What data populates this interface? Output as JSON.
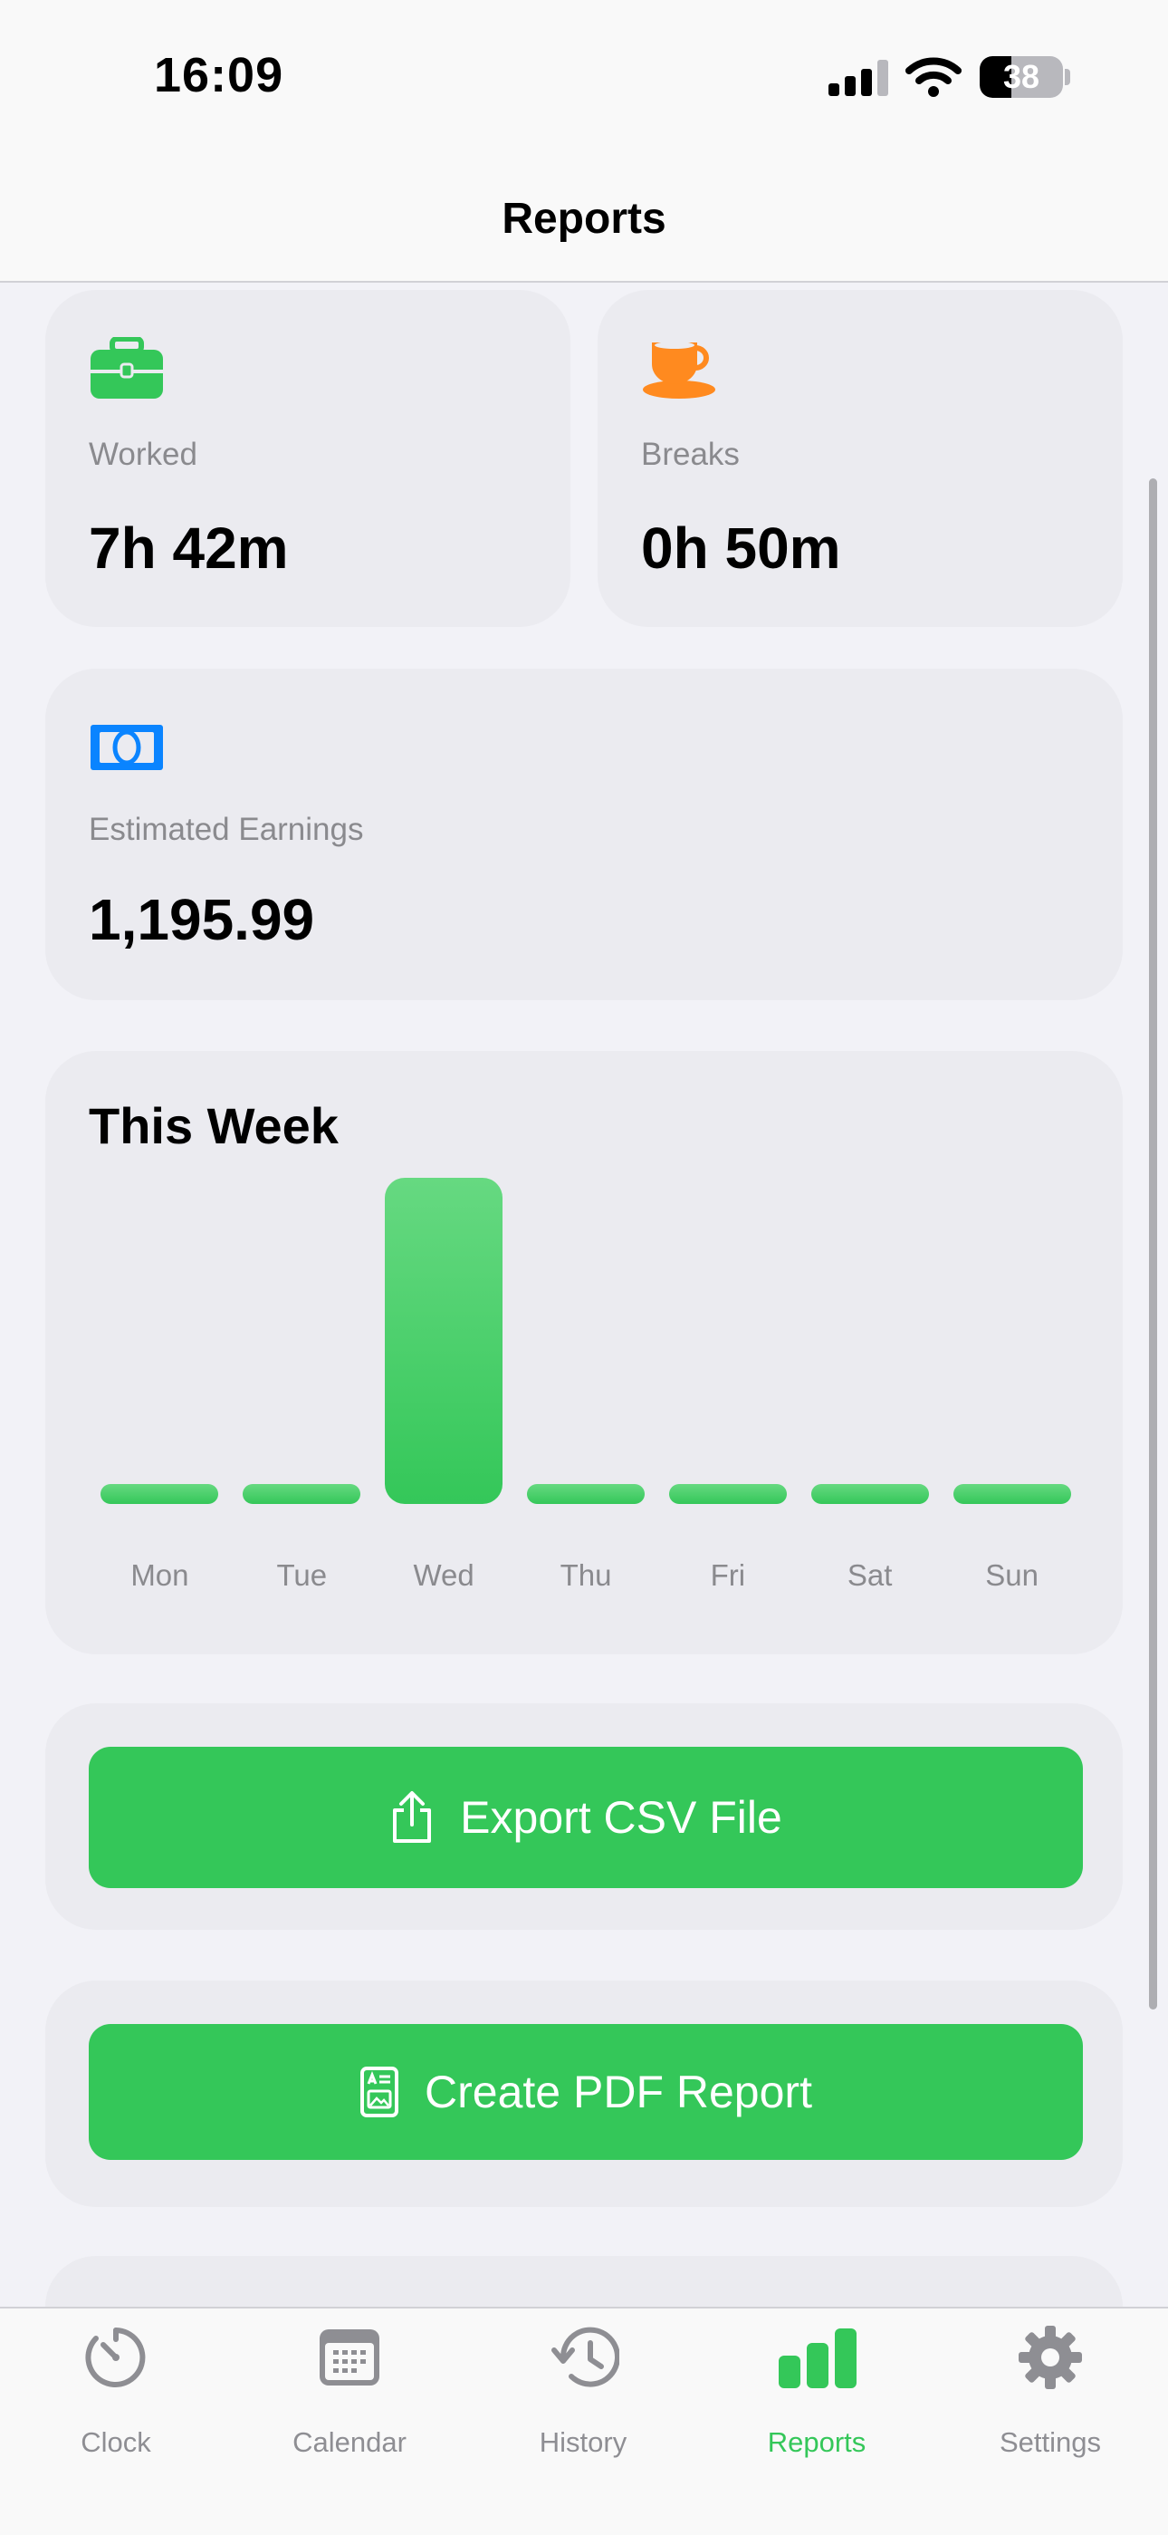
{
  "status_bar": {
    "time": "16:09",
    "battery_level": "38",
    "battery_fraction": 0.38
  },
  "nav": {
    "title": "Reports"
  },
  "stats": {
    "worked": {
      "label": "Worked",
      "value": "7h 42m",
      "icon": "briefcase-icon",
      "color": "#34C759"
    },
    "breaks": {
      "label": "Breaks",
      "value": "0h 50m",
      "icon": "coffee-cup-icon",
      "color": "#FF8A1F"
    },
    "earnings": {
      "label": "Estimated Earnings",
      "value": "1,195.99",
      "icon": "banknote-icon",
      "color": "#0A84FF"
    }
  },
  "chart_data": {
    "type": "bar",
    "title": "This Week",
    "categories": [
      "Mon",
      "Tue",
      "Wed",
      "Thu",
      "Fri",
      "Sat",
      "Sun"
    ],
    "values": [
      0,
      0,
      7.7,
      0,
      0,
      0,
      0
    ],
    "color": "#34C759"
  },
  "actions": {
    "export_csv": {
      "label": "Export CSV File",
      "icon": "share-icon"
    },
    "create_pdf": {
      "label": "Create PDF Report",
      "icon": "document-icon"
    }
  },
  "tab_bar": {
    "active": "Reports",
    "items": [
      {
        "label": "Clock",
        "icon": "timer-icon"
      },
      {
        "label": "Calendar",
        "icon": "calendar-icon"
      },
      {
        "label": "History",
        "icon": "history-icon"
      },
      {
        "label": "Reports",
        "icon": "bar-chart-icon"
      },
      {
        "label": "Settings",
        "icon": "gear-icon"
      }
    ]
  },
  "colors": {
    "accent": "#34C759",
    "background": "#F2F2F7",
    "card": "#EBEBF0",
    "inactive": "#8E8E93"
  }
}
